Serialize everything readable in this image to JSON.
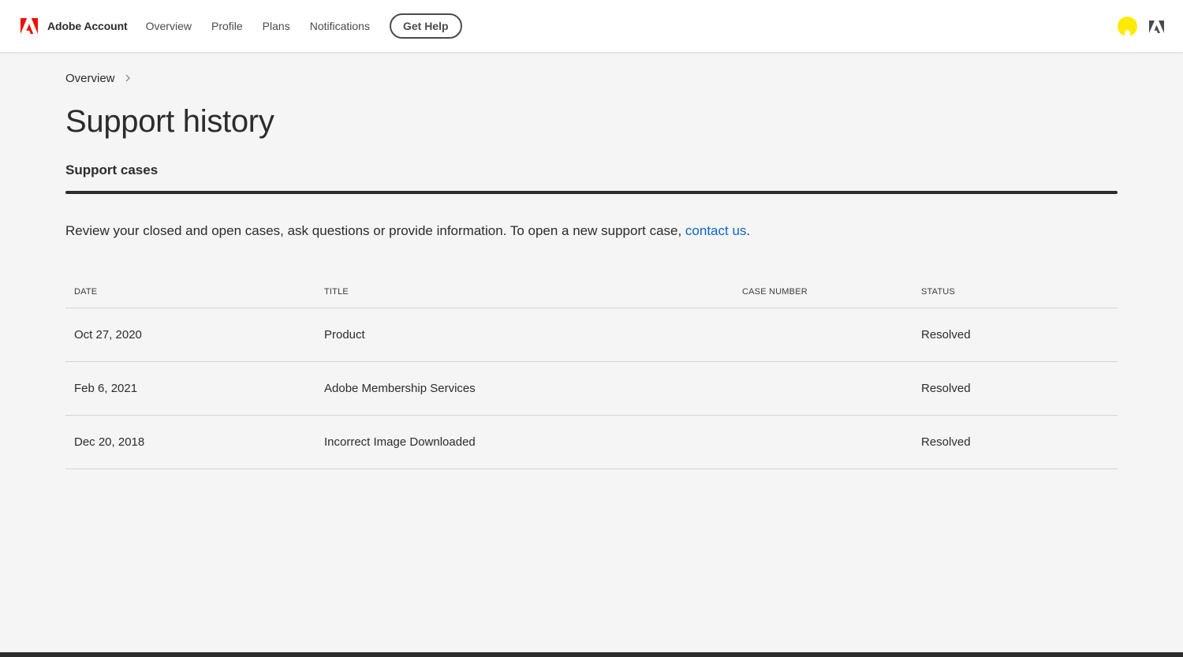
{
  "header": {
    "brand": "Adobe Account",
    "nav": [
      "Overview",
      "Profile",
      "Plans",
      "Notifications"
    ],
    "help_button": "Get Help",
    "brand_color": "#eb1000",
    "avatar_color": "#ffea00"
  },
  "breadcrumb": {
    "items": [
      "Overview"
    ]
  },
  "page": {
    "title": "Support history",
    "section_title": "Support cases",
    "intro_text": "Review your closed and open cases, ask questions or provide information. To open a new support case, ",
    "intro_link": "contact us",
    "intro_end": "."
  },
  "table": {
    "columns": [
      "DATE",
      "TITLE",
      "CASE NUMBER",
      "STATUS"
    ],
    "rows": [
      {
        "date": "Oct 27, 2020",
        "title": "Product",
        "case_number": "",
        "status": "Resolved"
      },
      {
        "date": "Feb 6, 2021",
        "title": "Adobe Membership Services",
        "case_number": "",
        "status": "Resolved"
      },
      {
        "date": "Dec 20, 2018",
        "title": "Incorrect Image Downloaded",
        "case_number": "",
        "status": "Resolved"
      }
    ]
  }
}
